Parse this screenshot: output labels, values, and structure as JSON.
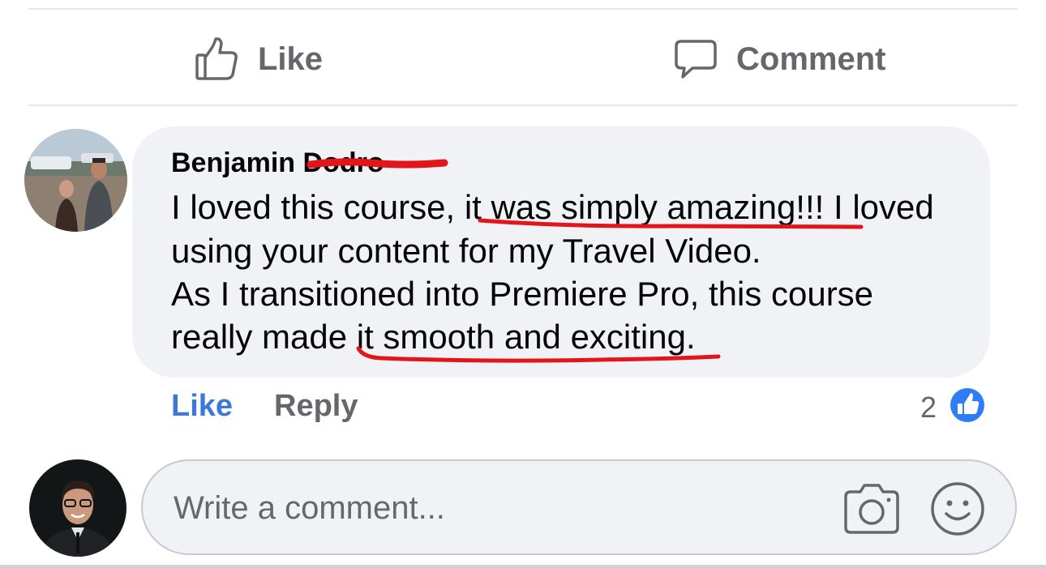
{
  "action_bar": {
    "like_label": "Like",
    "comment_label": "Comment",
    "like_icon": "thumbs-up-outline-icon",
    "comment_icon": "speech-bubble-icon"
  },
  "comment": {
    "author": "Benjamin",
    "author_surname_redacted": "Dodro",
    "lines": [
      [
        "I loved this course, ",
        "it was simply amazing!!!",
        " I loved"
      ],
      [
        "using your content for my Travel Video."
      ],
      [
        "As I transitioned into Premiere Pro, this course"
      ],
      [
        "really made ",
        "it smooth and exciting",
        "."
      ]
    ],
    "actions": {
      "like_label": "Like",
      "reply_label": "Reply"
    },
    "reaction_count": "2",
    "reaction_icon": "like-reaction-icon"
  },
  "composer": {
    "placeholder": "Write a comment...",
    "camera_icon": "camera-icon",
    "emoji_icon": "emoji-icon"
  },
  "colors": {
    "accent_blue": "#3b78d8",
    "secondary_text": "#65676b",
    "bubble_bg": "#f0f2f5",
    "annotation_red": "#e3151a"
  }
}
